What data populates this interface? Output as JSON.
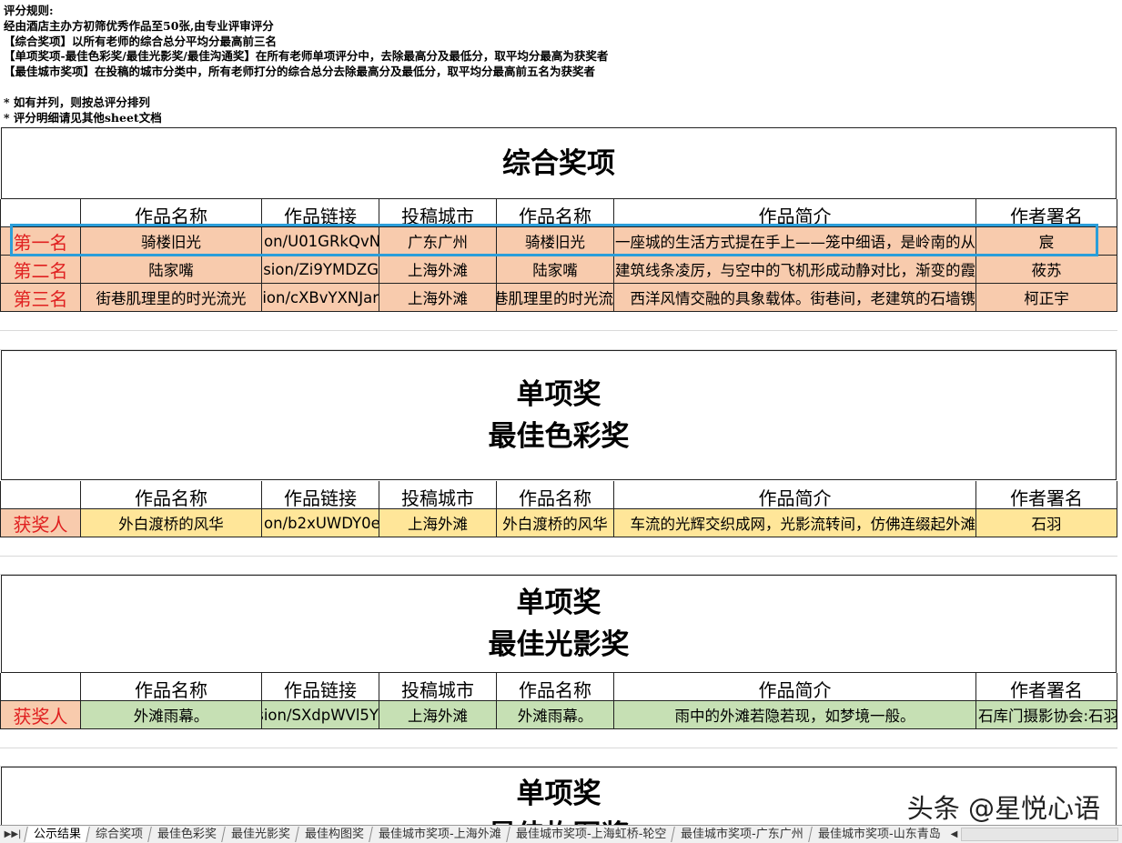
{
  "rules": {
    "lines": [
      "评分规则:",
      "经由酒店主办方初筛优秀作品至50张,由专业评审评分",
      "【综合奖项】以所有老师的综合总分平均分最高前三名",
      "【单项奖项-最佳色彩奖/最佳光影奖/最佳沟通奖】在所有老师单项评分中，去除最高分及最低分，取平均分最高为获奖者",
      "【最佳城市奖项】在投稿的城市分类中，所有老师打分的综合总分去除最高分及最低分，取平均分最高前五名为获奖者",
      "",
      "* 如有并列，则按总评分排列",
      "* 评分明细请见其他sheet文档"
    ]
  },
  "headers": [
    "作品名称",
    "作品链接",
    "投稿城市",
    "作品名称",
    "作品简介",
    "作者署名"
  ],
  "sections": {
    "overall": {
      "title": "综合奖项",
      "rows": [
        {
          "rank": "第一名",
          "name": "骑楼旧光",
          "link": "on/U01GRkQvN",
          "city": "广东广州",
          "name2": "骑楼旧光",
          "intro": "一座城的生活方式提在手上——笼中细语，是岭南的从",
          "author": "宸"
        },
        {
          "rank": "第二名",
          "name": "陆家嘴",
          "link": "sion/Zi9YMDZG",
          "city": "上海外滩",
          "name2": "陆家嘴",
          "intro": "建筑线条凌厉，与空中的飞机形成动静对比，渐变的霞",
          "author": "莜苏"
        },
        {
          "rank": "第三名",
          "name": "街巷肌理里的时光流光",
          "link": "sion/cXBvYXNJar",
          "city": "上海外滩",
          "name2": "巷肌理里的时光流",
          "intro": "西洋风情交融的具象载体。街巷间，老建筑的石墙镌",
          "author": "柯正宇"
        }
      ]
    },
    "color": {
      "title1": "单项奖",
      "title2": "最佳色彩奖",
      "row": {
        "rank": "获奖人",
        "name": "外白渡桥的风华",
        "link": "on/b2xUWDY0e",
        "city": "上海外滩",
        "name2": "外白渡桥的风华",
        "intro": "车流的光辉交织成网，光影流转间，仿佛连缀起外滩",
        "author": "石羽"
      }
    },
    "light": {
      "title1": "单项奖",
      "title2": "最佳光影奖",
      "row": {
        "rank": "获奖人",
        "name": "外滩雨幕。",
        "link": "sion/SXdpWVl5Y",
        "city": "上海外滩",
        "name2": "外滩雨幕。",
        "intro": "雨中的外滩若隐若现，如梦境一般。",
        "author": "石库门摄影协会:石羽"
      }
    },
    "next": {
      "title1": "单项奖",
      "title2": "最佳构图奖"
    }
  },
  "tabs": [
    "公示结果",
    "综合奖项",
    "最佳色彩奖",
    "最佳光影奖",
    "最佳构图奖",
    "最佳城市奖项-上海外滩",
    "最佳城市奖项-上海虹桥-轮空",
    "最佳城市奖项-广东广州",
    "最佳城市奖项-山东青岛"
  ],
  "active_tab": "公示结果",
  "watermark": "头条 @星悦心语",
  "colors": {
    "peach": "#f8cbad",
    "yellow": "#ffe699",
    "green": "#c6e0b4",
    "rank_text": "#e02020",
    "highlight": "#2b9ed9"
  }
}
